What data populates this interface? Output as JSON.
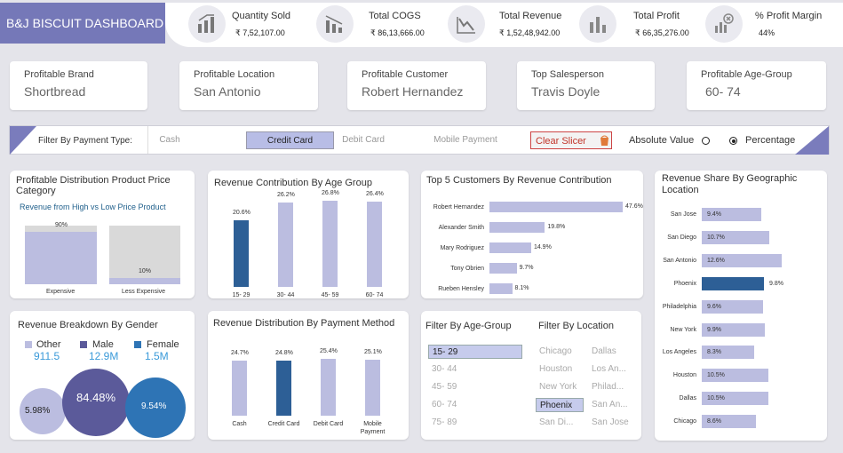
{
  "header": {
    "title": "B&J BISCUIT DASHBOARD",
    "kpis": [
      {
        "label": "Quantity Sold",
        "value": "₹ 7,52,107.00",
        "icon": "bar-chart-up-icon"
      },
      {
        "label": "Total COGS",
        "value": "₹ 86,13,666.00",
        "icon": "bar-chart-down-icon"
      },
      {
        "label": "Total Revenue",
        "value": "₹ 1,52,48,942.00",
        "icon": "line-chart-down-icon"
      },
      {
        "label": "Total Profit",
        "value": "₹ 66,35,276.00",
        "icon": "bar-chart-icon"
      },
      {
        "label": "% Profit Margin",
        "value": "44%",
        "icon": "chart-cancel-icon"
      }
    ]
  },
  "profitable": [
    {
      "label": "Profitable Brand",
      "value": "Shortbread"
    },
    {
      "label": "Profitable Location",
      "value": "San Antonio"
    },
    {
      "label": "Profitable Customer",
      "value": "Robert Hernandez"
    },
    {
      "label": "Top Salesperson",
      "value": "Travis Doyle"
    },
    {
      "label": "Profitable Age-Group",
      "value": "60- 74"
    }
  ],
  "filter": {
    "label": "Filter By Payment Type:",
    "options": [
      "Cash",
      "Credit Card",
      "Debit Card",
      "Mobile Payment"
    ],
    "selected": "Credit Card",
    "clear_label": "Clear Slicer",
    "radio_options": [
      "Absolute Value",
      "Percentage"
    ],
    "radio_selected": "Percentage"
  },
  "colors": {
    "accent": "#7578b8",
    "bar": "#bbbde0",
    "highlight": "#2d5f96",
    "bg": "#e4e4ea"
  },
  "price_category": {
    "title": "Profitable Distribution Product Price Category",
    "subtitle": "Revenue from High vs Low Price Product",
    "chart_data": {
      "type": "bar",
      "categories": [
        "Expensive",
        "Less Expensive"
      ],
      "values": [
        90,
        10
      ],
      "labels": [
        "90%",
        "10%"
      ],
      "ylim": [
        0,
        100
      ]
    }
  },
  "age_group": {
    "title": "Revenue Contribution By Age Group",
    "chart_data": {
      "type": "bar",
      "categories": [
        "15- 29",
        "30- 44",
        "45- 59",
        "60- 74"
      ],
      "values": [
        20.6,
        26.2,
        26.8,
        26.4
      ],
      "labels": [
        "20.6%",
        "26.2%",
        "26.8%",
        "26.4%"
      ],
      "highlight": "15- 29"
    }
  },
  "top_customers": {
    "title": "Top 5 Customers By Revenue Contribution",
    "chart_data": {
      "type": "bar",
      "orientation": "horizontal",
      "categories": [
        "Robert Hernandez",
        "Alexander Smith",
        "Mary Rodriguez",
        "Tony Obrien",
        "Rueben Hensley"
      ],
      "values": [
        47.6,
        19.8,
        14.9,
        9.7,
        8.1
      ],
      "labels": [
        "47.6%",
        "19.8%",
        "14.9%",
        "9.7%",
        "8.1%"
      ]
    }
  },
  "geo": {
    "title": "Revenue Share By Geographic Location",
    "chart_data": {
      "type": "bar",
      "orientation": "horizontal",
      "categories": [
        "San Jose",
        "San Diego",
        "San Antonio",
        "Phoenix",
        "Philadelphia",
        "New York",
        "Los Angeles",
        "Houston",
        "Dallas",
        "Chicago"
      ],
      "values": [
        9.4,
        10.7,
        12.6,
        9.8,
        9.6,
        9.9,
        8.3,
        10.5,
        10.5,
        8.6
      ],
      "labels": [
        "9.4%",
        "10.7%",
        "12.6%",
        "9.8%",
        "9.6%",
        "9.9%",
        "8.3%",
        "10.5%",
        "10.5%",
        "8.6%"
      ],
      "highlight": "Phoenix"
    }
  },
  "gender": {
    "title": "Revenue Breakdown By Gender",
    "legend": [
      {
        "label": "Other",
        "value": "911.5",
        "color": "#bbbde0"
      },
      {
        "label": "Male",
        "value": "12.9M",
        "color": "#5b5a9a"
      },
      {
        "label": "Female",
        "value": "1.5M",
        "color": "#2e74b5"
      }
    ],
    "chart_data": {
      "type": "bubble",
      "categories": [
        "Other",
        "Male",
        "Female"
      ],
      "values": [
        5.98,
        84.48,
        9.54
      ],
      "labels": [
        "5.98%",
        "84.48%",
        "9.54%"
      ]
    }
  },
  "payment": {
    "title": "Revenue Distribution By Payment Method",
    "chart_data": {
      "type": "bar",
      "categories": [
        "Cash",
        "Credit Card",
        "Debit Card",
        "Mobile Payment"
      ],
      "values": [
        24.7,
        24.8,
        25.4,
        25.1
      ],
      "labels": [
        "24.7%",
        "24.8%",
        "25.4%",
        "25.1%"
      ],
      "highlight": "Credit Card"
    }
  },
  "age_filter": {
    "title": "Filter By Age-Group",
    "options": [
      "15- 29",
      "30- 44",
      "45- 59",
      "60- 74",
      "75- 89"
    ],
    "selected": "15- 29"
  },
  "loc_filter": {
    "title": "Filter By Location",
    "options": [
      "Chicago",
      "Dallas",
      "Houston",
      "Los An...",
      "New York",
      "Philad...",
      "Phoenix",
      "San An...",
      "San Di...",
      "San Jose"
    ],
    "selected": "Phoenix"
  }
}
